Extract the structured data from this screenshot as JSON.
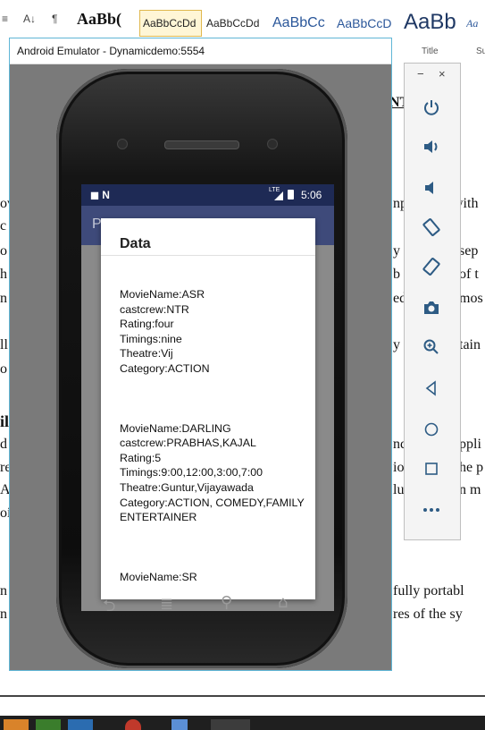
{
  "word": {
    "ribbon": {
      "buttons": [
        "≡",
        "A↓",
        "¶"
      ],
      "styles": [
        "AaBb(",
        "AaBbCcDd",
        "AaBbCcDd",
        "AaBbCc",
        "AaBbCcD",
        "AaBb",
        "Aa"
      ],
      "captions": [
        "Title",
        "Su"
      ]
    },
    "fragments": {
      "f_nt": "NT",
      "f_ov": "ov",
      "f_c1": "c",
      "f_o1": "o",
      "f_h": "h",
      "f_n1": "n",
      "f_ll": "ll",
      "f_o2": "o",
      "f_il": "il",
      "f_d": "d",
      "f_re": "re",
      "f_al": "Al",
      "f_oi": "oi",
      "f_n2": "n",
      "f_n3": "n",
      "r_np": "np",
      "r_with": "with",
      "r_y": "y",
      "r_sep": "sep",
      "r_b": "b",
      "r_oft": "of t",
      "r_ed": "ed",
      "r_mos": "mos",
      "r_y2": "y",
      "r_tain": "tain",
      "r_nd": "nd",
      "r_ppli": "ppli",
      "r_io": "io",
      "r_hep": "he p",
      "r_lu": "lu",
      "r_nm": "n m",
      "r_fully": "fully portabl",
      "r_res": "res of the sy"
    }
  },
  "emulator": {
    "title": "Android Emulator - Dynamicdemo:5554",
    "statusbar": {
      "time": "5:06",
      "left_icons": "◼ N",
      "signal": "LTE"
    },
    "app_title": "P",
    "dialog": {
      "title": "Data",
      "records": [
        [
          "MovieName:ASR",
          "castcrew:NTR",
          "Rating:four",
          "Timings:nine",
          "Theatre:Vij",
          "Category:ACTION"
        ],
        [
          "MovieName:DARLING",
          "castcrew:PRABHAS,KAJAL",
          "Rating:5",
          "Timings:9:00,12:00,3:00,7:00",
          "Theatre:Guntur,Vijayawada",
          "Category:ACTION, COMEDY,FAMILY ENTERTAINER"
        ],
        [
          "MovieName:SR"
        ]
      ]
    },
    "sidebar": {
      "minimize": "−",
      "close": "×",
      "icons": [
        "power-icon",
        "volume-up-icon",
        "volume-down-icon",
        "rotate-left-icon",
        "rotate-right-icon",
        "camera-icon",
        "zoom-icon",
        "back-icon",
        "home-icon",
        "overview-icon",
        "more-icon"
      ]
    }
  }
}
